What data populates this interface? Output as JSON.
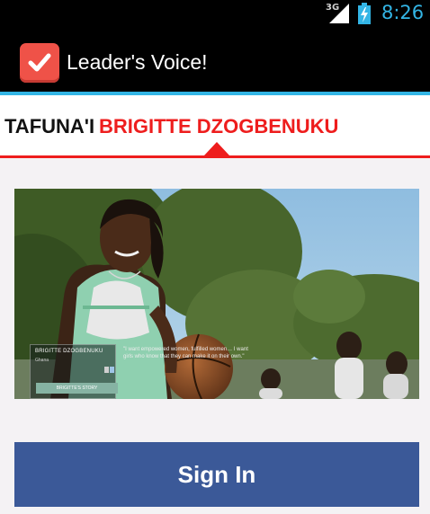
{
  "status_bar": {
    "network_type": "3G",
    "time": "8:26",
    "clock_color": "#33b5e5"
  },
  "action_bar": {
    "app_title": "Leader's Voice!",
    "icon": "checkbox-icon",
    "accent": "#33b5e5"
  },
  "tabs": {
    "previous_label": "TAFUNA'I",
    "current_label": "BRIGITTE DZOGBENUKU",
    "active_color": "#ee1d1d"
  },
  "photo_card": {
    "caption_name": "BRIGITTE DZOGBENUKU",
    "caption_sub": "Ghana",
    "story_button_label": "BRIGITTE'S STORY",
    "quote": "\"I want empowered women, fulfilled women… I want girls who know that they can make it on their own.\""
  },
  "sign_in": {
    "label": "Sign In",
    "color": "#3b5998"
  }
}
